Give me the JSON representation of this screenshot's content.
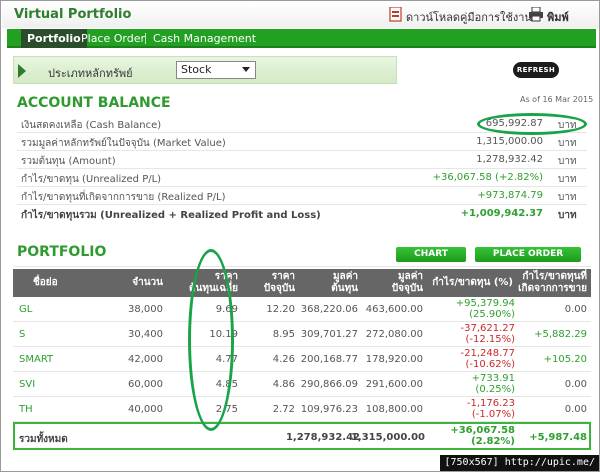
{
  "app": {
    "title": "Virtual Portfolio"
  },
  "header": {
    "download_label": "ดาวน์โหลดคู่มือการใช้งาน",
    "print_label": "พิมพ์"
  },
  "nav": {
    "tabs": [
      {
        "label": "Portfolio",
        "active": true
      },
      {
        "label": "Place Order",
        "active": false
      },
      {
        "label": "Cash Management",
        "active": false
      }
    ]
  },
  "filter": {
    "label": "ประเภทหลักทรัพย์",
    "selected": "Stock",
    "refresh_label": "REFRESH"
  },
  "account": {
    "title": "ACCOUNT BALANCE",
    "as_of": "As of 16 Mar 2015",
    "unit": "บาท",
    "rows": [
      {
        "label": "เงินสดคงเหลือ (Cash Balance)",
        "value": "695,992.87",
        "tone": "normal"
      },
      {
        "label": "รวมมูลค่าหลักทรัพย์ในปัจจุบัน (Market Value)",
        "value": "1,315,000.00",
        "tone": "normal"
      },
      {
        "label": "รวมต้นทุน (Amount)",
        "value": "1,278,932.42",
        "tone": "normal"
      },
      {
        "label": "กำไร/ขาดทุน (Unrealized P/L)",
        "value": "+36,067.58 (+2.82%)",
        "tone": "green"
      },
      {
        "label": "กำไร/ขาดทุนที่เกิดจากการขาย (Realized P/L)",
        "value": "+973,874.79",
        "tone": "green"
      },
      {
        "label": "กำไร/ขาดทุนรวม (Unrealized + Realized Profit and Loss)",
        "value": "+1,009,942.37",
        "tone": "green"
      }
    ]
  },
  "portfolio": {
    "title": "PORTFOLIO",
    "chart_button": "CHART",
    "order_button": "PLACE ORDER",
    "headers": {
      "symbol": "ชื่อย่อ",
      "qty": "จำนวน",
      "avg_cost_1": "ราคา",
      "avg_cost_2": "ต้นทุนเฉลี่ย",
      "price_1": "ราคา",
      "price_2": "ปัจจุบัน",
      "cost_1": "มูลค่า",
      "cost_2": "ต้นทุน",
      "mkt_1": "มูลค่า",
      "mkt_2": "ปัจจุบัน",
      "upl": "กำไร/ขาดทุน (%)",
      "rpl_1": "กำไร/ขาดทุนที่",
      "rpl_2": "เกิดจากการขาย"
    },
    "rows": [
      {
        "symbol": "GL",
        "qty": "38,000",
        "avg": "9.69",
        "price": "12.20",
        "cost": "368,220.06",
        "mkt": "463,600.00",
        "upl": "+95,379.94",
        "upl_pct": "(25.90%)",
        "tone": "green",
        "rpl": "0.00",
        "rpl_tone": "normal"
      },
      {
        "symbol": "S",
        "qty": "30,400",
        "avg": "10.19",
        "price": "8.95",
        "cost": "309,701.27",
        "mkt": "272,080.00",
        "upl": "-37,621.27",
        "upl_pct": "(-12.15%)",
        "tone": "red",
        "rpl": "+5,882.29",
        "rpl_tone": "green"
      },
      {
        "symbol": "SMART",
        "qty": "42,000",
        "avg": "4.77",
        "price": "4.26",
        "cost": "200,168.77",
        "mkt": "178,920.00",
        "upl": "-21,248.77",
        "upl_pct": "(-10.62%)",
        "tone": "red",
        "rpl": "+105.20",
        "rpl_tone": "green"
      },
      {
        "symbol": "SVI",
        "qty": "60,000",
        "avg": "4.85",
        "price": "4.86",
        "cost": "290,866.09",
        "mkt": "291,600.00",
        "upl": "+733.91",
        "upl_pct": "(0.25%)",
        "tone": "green",
        "rpl": "0.00",
        "rpl_tone": "normal"
      },
      {
        "symbol": "TH",
        "qty": "40,000",
        "avg": "2.75",
        "price": "2.72",
        "cost": "109,976.23",
        "mkt": "108,800.00",
        "upl": "-1,176.23",
        "upl_pct": "(-1.07%)",
        "tone": "red",
        "rpl": "0.00",
        "rpl_tone": "normal"
      }
    ],
    "total": {
      "label": "รวมทั้งหมด",
      "cost": "1,278,932.42",
      "mkt": "1,315,000.00",
      "upl": "+36,067.58",
      "upl_pct": "(2.82%)",
      "rpl": "+5,987.48"
    }
  },
  "watermark": "[750x567] http://upic.me/",
  "colors": {
    "brand_green": "#2fa02f",
    "nav_green": "#22a022",
    "loss_red": "#cc2a2a",
    "highlight_ellipse": "#1aa34a"
  }
}
